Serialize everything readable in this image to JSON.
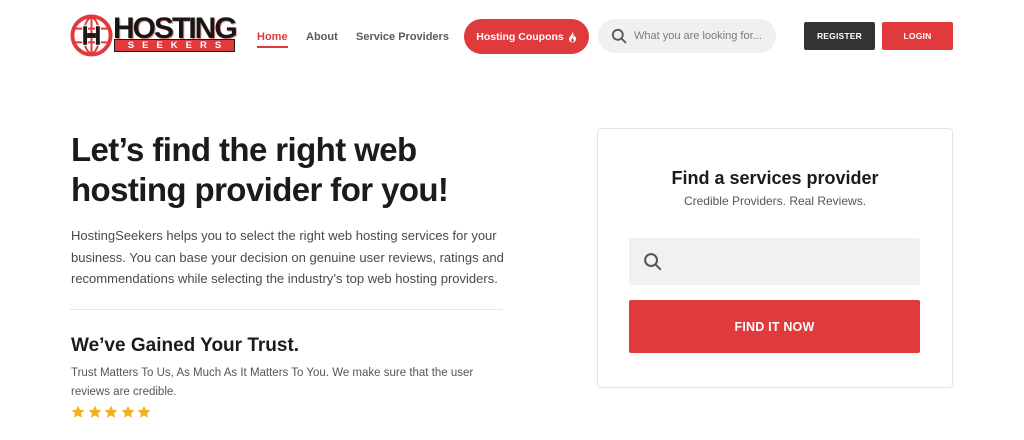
{
  "header": {
    "logo": {
      "top_text": "HOSTING",
      "bottom_text": "SEEKERS",
      "icon": "globe-icon"
    },
    "nav": [
      {
        "label": "Home",
        "active": true
      },
      {
        "label": "About",
        "active": false
      },
      {
        "label": "Service Providers",
        "active": false
      }
    ],
    "coupons": {
      "label": "Hosting Coupons",
      "icon": "fire-icon"
    },
    "search": {
      "placeholder": "What you are looking for...",
      "icon": "search-icon"
    },
    "register_label": "REGISTER",
    "login_label": "LOGIN"
  },
  "hero": {
    "title": "Let’s find the right web hosting provider for you!",
    "description": "HostingSeekers helps you to select the right web hosting services for your business. You can base your decision on genuine user reviews, ratings and recommendations while selecting the industry’s top web hosting providers.",
    "trust": {
      "title": "We’ve Gained Your Trust.",
      "text": "Trust Matters To Us, As Much As It Matters To You. We make sure that the user reviews are credible.",
      "rating": 5,
      "rating_max": 5,
      "star_icon": "star-icon"
    }
  },
  "finder": {
    "title": "Find a services provider",
    "subtitle": "Credible Providers. Real Reviews.",
    "search_icon": "search-icon",
    "button_label": "FIND IT NOW"
  },
  "colors": {
    "accent": "#e03a3c",
    "dark": "#333333",
    "star": "#f2b01e"
  }
}
